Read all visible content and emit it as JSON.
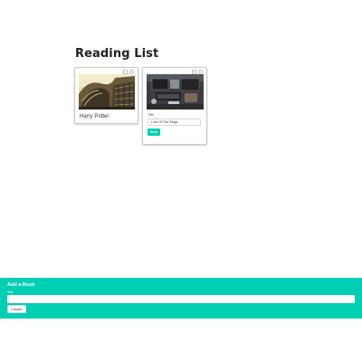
{
  "page": {
    "title": "Reading List"
  },
  "books": [
    {
      "title": "Harry Potter",
      "cover_icon": "library-arches-photo",
      "actions": [
        "edit-icon",
        "delete-icon"
      ]
    },
    {
      "mode": "editing",
      "cover_icon": "office-desk-photo",
      "field_label": "Title",
      "title_value": "Lord Of The Rings",
      "save_label": "Save",
      "actions": [
        "edit-icon",
        "delete-icon"
      ]
    }
  ],
  "add_form": {
    "heading": "Add a Book",
    "title_label": "Title",
    "title_value": "",
    "create_label": "Create!"
  },
  "colors": {
    "accent": "#00cfb3",
    "card_border": "#c8c8c8",
    "text": "#222222"
  }
}
